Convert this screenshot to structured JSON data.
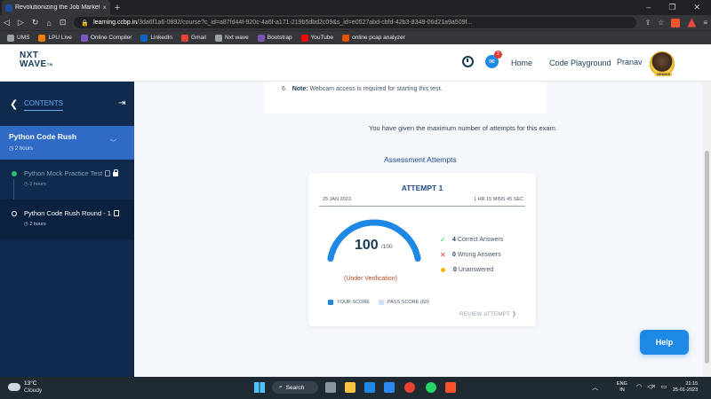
{
  "browser": {
    "tab_title": "Revolutionizing the Job Market |",
    "tab_close": "×",
    "new_tab": "+",
    "url_domain": "learning.ccbp.in",
    "url_path": "/3da6f1a6-0892/course?c_id=a87fd44f-920c-4a6f-a171-219b5dbd2c09&s_id=e0527abd-cbfd-42b3-8348-06d21a9a509f...",
    "window_controls": [
      "–",
      "❐",
      "✕"
    ],
    "bookmarks": [
      {
        "label": "UMS",
        "color": "#9aa0a6"
      },
      {
        "label": "LPU Live",
        "color": "#f57c00"
      },
      {
        "label": "Online Compiler",
        "color": "#7e57c2"
      },
      {
        "label": "LinkedIn",
        "color": "#0a66c2"
      },
      {
        "label": "Gmail",
        "color": "#ea4335"
      },
      {
        "label": "Nxt wave",
        "color": "#9aa0a6"
      },
      {
        "label": "Bootstrap",
        "color": "#7952b3"
      },
      {
        "label": "YouTube",
        "color": "#ff0000"
      },
      {
        "label": "online pcap analyzer",
        "color": "#e65100"
      }
    ]
  },
  "header": {
    "logo_line1": "NXT",
    "logo_line2": "WAVE",
    "logo_tm": "TM",
    "notification_count": "2",
    "nav_home": "Home",
    "nav_playground": "Code Playground",
    "user_name": "Pranav",
    "avatar_tag": "GENIUS"
  },
  "sidebar": {
    "contents_label": "CONTENTS",
    "section": {
      "title": "Python Code Rush",
      "time": "2 hours"
    },
    "items": [
      {
        "title": "Python Mock Practice Test",
        "time": "2 hours",
        "status": "completed"
      },
      {
        "title": "Python Code Rush Round - 1",
        "time": "2 hours",
        "status": "current"
      }
    ]
  },
  "main": {
    "note_number": "6.",
    "note_bold": "Note:",
    "note_text": " Webcam access is required for starting this test.",
    "max_attempts_msg": "You have given the maximum number of attempts for this exam.",
    "assessment_title": "Assessment Attempts",
    "attempt": {
      "title": "ATTEMPT 1",
      "date": "25 JAN 2023",
      "duration": "1 HR 15 MINS 45 SEC",
      "score": "100",
      "score_total": "/100",
      "score_fraction": 1.0,
      "pass_score_fraction": 0.6,
      "status": "(Under Verification)",
      "correct_count": "4",
      "correct_label": "Correct Answers",
      "wrong_count": "0",
      "wrong_label": "Wrong Answers",
      "unanswered_count": "0",
      "unanswered_label": "Unanswered",
      "legend_your": "YOUR SCORE",
      "legend_pass": "PASS SCORE (60)",
      "review_label": "REVIEW ATTEMPT",
      "colors": {
        "your_score": "#1e88e5",
        "pass_score": "#cfe3f7"
      }
    },
    "help_label": "Help"
  },
  "taskbar": {
    "temp": "13°C",
    "weather": "Cloudy",
    "search_label": "Search",
    "lang_line1": "ENG",
    "lang_line2": "IN",
    "time": "21:15",
    "date": "25-01-2023"
  }
}
